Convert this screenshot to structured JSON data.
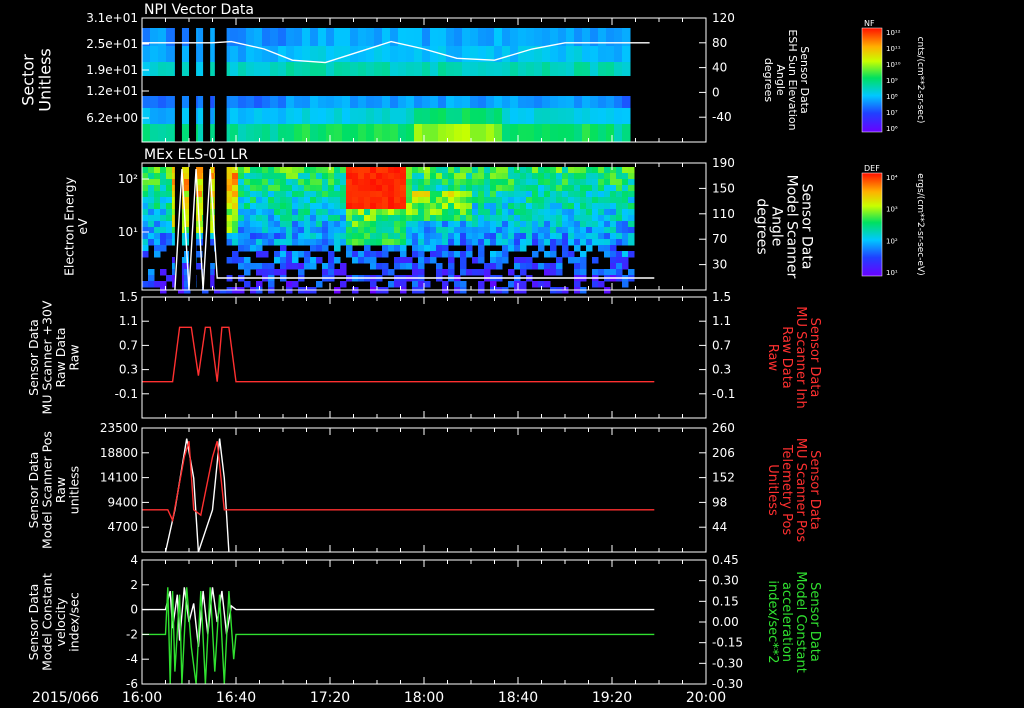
{
  "chart_data": {
    "type": "multi-panel",
    "x_ticks": [
      "16:00",
      "16:40",
      "17:20",
      "18:00",
      "18:40",
      "19:20",
      "20:00"
    ],
    "x_prefix": "2015/066",
    "panels": [
      {
        "id": "npi",
        "type": "heatmap",
        "title": "NPI Vector Data",
        "ylabel_left": [
          "Sector",
          "Unitless"
        ],
        "yticks_left": [
          "3.1e+01",
          "2.5e+01",
          "1.9e+01",
          "1.2e+01",
          "6.2e+00"
        ],
        "ylabel_right": [
          "Sensor Data",
          "ESH Sun Elevation",
          "Angle",
          "degrees"
        ],
        "yticks_right": [
          "120",
          "80",
          "40",
          "0",
          "-40"
        ],
        "yrange_right": [
          -80,
          120
        ],
        "line": {
          "times_min": [
            0,
            14,
            20,
            26,
            30,
            38,
            52,
            64,
            78,
            92,
            106,
            120,
            134,
            150,
            166,
            180,
            196,
            216
          ],
          "values": [
            80,
            80,
            80,
            80,
            80,
            82,
            70,
            52,
            48,
            65,
            82,
            70,
            55,
            52,
            70,
            80,
            80,
            80
          ]
        },
        "colorbar": {
          "label": "NF",
          "ticks": [
            "10¹²",
            "10¹¹",
            "10¹⁰",
            "10⁹",
            "10⁸",
            "10⁷",
            "10⁶"
          ],
          "units": "cnts/(cm**2-sr-sec)"
        }
      },
      {
        "id": "els",
        "type": "heatmap",
        "title": "MEx ELS-01 LR",
        "ylabel_left": [
          "Electron Energy",
          "eV"
        ],
        "yticks_left": [
          "10²",
          "10¹"
        ],
        "ylabel_right": [
          "Sensor Data",
          "Model Scanner",
          "Angle",
          "degrees"
        ],
        "yticks_right": [
          "190",
          "150",
          "110",
          "70",
          "30"
        ],
        "yrange_right": [
          -10,
          190
        ],
        "colorbar": {
          "label": "DEF",
          "ticks": [
            "10⁴",
            "10³",
            "10²",
            "10¹"
          ],
          "units": "ergs/(cm**2-sr-sec-eV)"
        }
      },
      {
        "id": "plus30",
        "type": "line",
        "ylabel_left": [
          "Sensor Data",
          "MU Scanner +30V",
          "Raw Data",
          "Raw"
        ],
        "yticks_left": [
          "1.5",
          "1.1",
          "0.7",
          "0.3",
          "-0.1"
        ],
        "yrange": [
          -0.5,
          1.5
        ],
        "ylabel_right": [
          "Sensor Data",
          "MU Scanner Inh",
          "Raw Data",
          "Raw"
        ],
        "yticks_right": [
          "1.5",
          "1.1",
          "0.7",
          "0.3",
          "-0.1"
        ],
        "series": [
          {
            "color": "#ff3030",
            "times_min": [
              0,
              11,
              13,
              16,
              18,
              21,
              24,
              27,
              29,
              32,
              34,
              37,
              40,
              60,
              120,
              180,
              218
            ],
            "values": [
              0.1,
              0.1,
              0.1,
              1.0,
              1.0,
              1.0,
              0.2,
              1.0,
              1.0,
              0.1,
              1.0,
              1.0,
              0.1,
              0.1,
              0.1,
              0.1,
              0.1
            ]
          }
        ]
      },
      {
        "id": "pos",
        "type": "line",
        "ylabel_left": [
          "Sensor Data",
          "Model Scanner Pos",
          "Raw",
          "unitless"
        ],
        "yticks_left": [
          "23500",
          "18800",
          "14100",
          "9400",
          "4700"
        ],
        "yrange": [
          0,
          23500
        ],
        "ylabel_right": [
          "Sensor Data",
          "MU Scanner Pos",
          "Telemetry Pos",
          "Unitless"
        ],
        "yticks_right": [
          "260",
          "206",
          "152",
          "98",
          "44"
        ],
        "series": [
          {
            "color": "#ffffff",
            "times_min": [
              10,
              14,
              19,
              22,
              24,
              30,
              33,
              35,
              37
            ],
            "values": [
              0,
              8000,
              21500,
              14000,
              0,
              8000,
              21500,
              14000,
              0
            ]
          },
          {
            "color": "#ff3030",
            "times_min": [
              0,
              11,
              13,
              18,
              20,
              22,
              25,
              30,
              32,
              35,
              37,
              40,
              60,
              120,
              180,
              218
            ],
            "values": [
              8000,
              8000,
              6000,
              18000,
              21000,
              8000,
              7000,
              18000,
              21000,
              8000,
              8000,
              8000,
              8000,
              8000,
              8000,
              8000
            ]
          }
        ]
      },
      {
        "id": "vel",
        "type": "line",
        "ylabel_left": [
          "Sensor Data",
          "Model Constant",
          "velocity",
          "index/sec"
        ],
        "yticks_left": [
          "4",
          "2",
          "0",
          "-2",
          "-4",
          "-6"
        ],
        "yrange": [
          -6,
          4
        ],
        "ylabel_right": [
          "Sensor Data",
          "Model Constant",
          "acceleration",
          "index/sec**2"
        ],
        "yticks_right": [
          "0.45",
          "0.30",
          "0.15",
          "0.00",
          "-0.15",
          "-0.30"
        ],
        "series": [
          {
            "color": "#ffffff",
            "times_min": [
              0,
              10,
              12,
              13,
              15,
              16,
              18,
              20,
              22,
              24,
              26,
              28,
              30,
              32,
              34,
              36,
              38,
              40,
              218
            ],
            "values": [
              0,
              0,
              1.5,
              -1.5,
              1.2,
              -2.5,
              1.8,
              -1.0,
              0.5,
              -3,
              1.5,
              -2,
              1.8,
              -1,
              1.5,
              -2,
              0.3,
              0,
              0
            ]
          },
          {
            "color": "#30e030",
            "times_min": [
              0,
              10,
              11,
              12,
              13,
              14,
              16,
              17,
              19,
              21,
              23,
              25,
              27,
              29,
              31,
              33,
              35,
              37,
              39,
              40,
              218
            ],
            "values": [
              -2,
              -2,
              1.8,
              -6,
              1.5,
              -5,
              1.2,
              -6,
              1.8,
              -3,
              -6,
              1.5,
              -6,
              1.8,
              -5,
              1.2,
              -6,
              1.5,
              -4,
              -2,
              -2
            ]
          }
        ]
      }
    ]
  }
}
